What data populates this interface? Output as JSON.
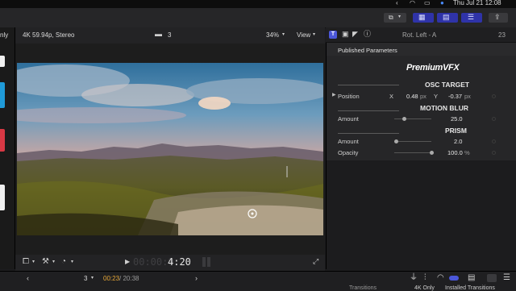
{
  "menubar": {
    "datetime": "Thu Jul 21  12:08"
  },
  "viewer": {
    "partial_left_label": "nly",
    "format": "4K 59.94p, Stereo",
    "clip_count": "3",
    "zoom": "34%",
    "view_menu": "View",
    "timecode_dim": "00:00:0",
    "timecode": "4:20"
  },
  "inspector": {
    "effect_name": "Rot. Left - A",
    "frame_count": "23",
    "published_parameters": "Published Parameters",
    "brand": "PremiumVFX",
    "osc_target": {
      "title": "OSC TARGET",
      "position_label": "Position",
      "x_label": "X",
      "x_value": "0.48",
      "x_unit": "px",
      "y_label": "Y",
      "y_value": "-0.37",
      "y_unit": "px"
    },
    "motion_blur": {
      "title": "MOTION BLUR",
      "amount_label": "Amount",
      "amount_value": "25.0",
      "amount_fraction": 0.25
    },
    "prism": {
      "title": "PRISM",
      "amount_label": "Amount",
      "amount_value": "2.0",
      "amount_fraction": 0.05,
      "opacity_label": "Opacity",
      "opacity_value": "100.0",
      "opacity_unit": "%",
      "opacity_fraction": 1.0
    }
  },
  "bottombar": {
    "index_value": "3",
    "timecode_current": "00:23",
    "timecode_total": "/ 20:38",
    "transitions_label": "Transitions",
    "filter_label": "4K Only",
    "installed_label": "Installed Transitions"
  },
  "colors": {
    "accent": "#2f33a8",
    "timecode_orange": "#e8a838",
    "inspector_tab_active": "#4b57d9"
  }
}
